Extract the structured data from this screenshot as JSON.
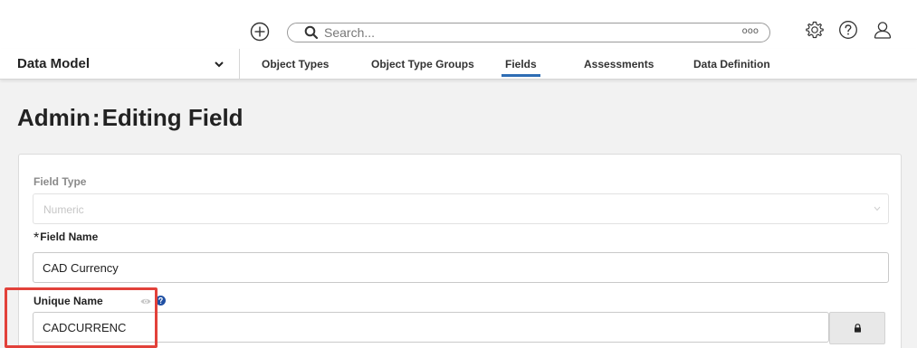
{
  "header": {
    "search_placeholder": "Search...",
    "search_more": "ooo",
    "icons": [
      "add-icon",
      "search-icon",
      "more-icon",
      "settings-icon",
      "help-icon",
      "user-icon"
    ]
  },
  "nav": {
    "module": "Data Model",
    "tabs": [
      {
        "label": "Object Types",
        "active": false
      },
      {
        "label": "Object Type Groups",
        "active": false
      },
      {
        "label": "Fields",
        "active": true
      },
      {
        "label": "Assessments",
        "active": false
      },
      {
        "label": "Data Definition",
        "active": false
      }
    ]
  },
  "page": {
    "title_prefix": "Admin",
    "title_sep": ":",
    "title_main": "Editing Field"
  },
  "form": {
    "field_type": {
      "label": "Field Type",
      "value": "Numeric"
    },
    "field_name": {
      "required_marker": "*",
      "label": "Field Name",
      "value": "CAD Currency"
    },
    "unique_name": {
      "label": "Unique Name",
      "value": "CADCURRENC"
    }
  },
  "colors": {
    "accent": "#2e6db4",
    "highlight": "#e2413a",
    "help": "#1f4fa3"
  }
}
